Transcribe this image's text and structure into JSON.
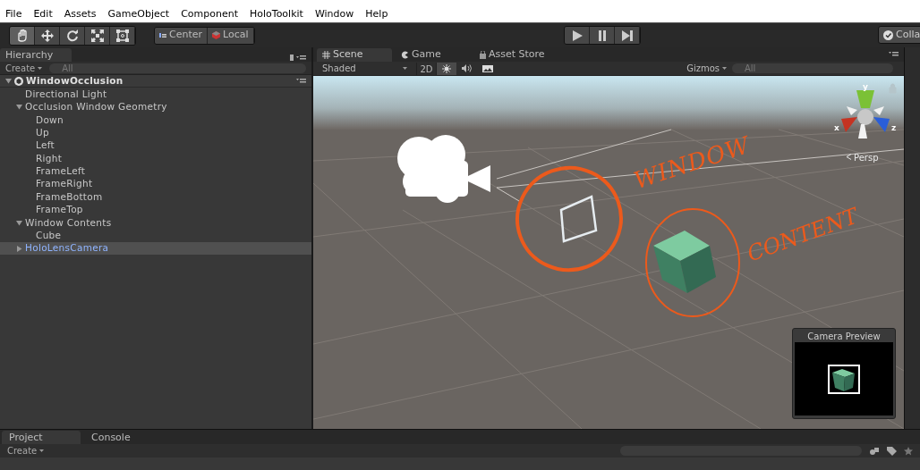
{
  "menu": [
    "File",
    "Edit",
    "Assets",
    "GameObject",
    "Component",
    "HoloToolkit",
    "Window",
    "Help"
  ],
  "toolbar": {
    "tools": [
      {
        "kind": "hand",
        "selected": true
      },
      {
        "kind": "move",
        "selected": false
      },
      {
        "kind": "rotate",
        "selected": false
      },
      {
        "kind": "scale",
        "selected": false
      },
      {
        "kind": "rect",
        "selected": false
      }
    ],
    "pivot": [
      "Center",
      "Local"
    ],
    "collab": "Colla"
  },
  "hierarchy": {
    "tab": "Hierarchy",
    "create": "Create",
    "search": {
      "placeholder": "All"
    },
    "tree": [
      {
        "label": "WindowOcclusion",
        "kind": "scene",
        "expanded": true,
        "selected": false,
        "children": [
          {
            "label": "Directional Light",
            "kind": "object",
            "selected": false
          },
          {
            "label": "Occlusion Window Geometry",
            "kind": "object",
            "expanded": true,
            "selected": false,
            "children": [
              {
                "label": "Down",
                "kind": "object",
                "selected": false
              },
              {
                "label": "Up",
                "kind": "object",
                "selected": false
              },
              {
                "label": "Left",
                "kind": "object",
                "selected": false
              },
              {
                "label": "Right",
                "kind": "object",
                "selected": false
              },
              {
                "label": "FrameLeft",
                "kind": "object",
                "selected": false
              },
              {
                "label": "FrameRight",
                "kind": "object",
                "selected": false
              },
              {
                "label": "FrameBottom",
                "kind": "object",
                "selected": false
              },
              {
                "label": "FrameTop",
                "kind": "object",
                "selected": false
              }
            ]
          },
          {
            "label": "Window Contents",
            "kind": "object",
            "expanded": true,
            "selected": false,
            "children": [
              {
                "label": "Cube",
                "kind": "object",
                "selected": false
              }
            ]
          },
          {
            "label": "HoloLensCamera",
            "kind": "prefab",
            "expanded": false,
            "selected": true
          }
        ]
      }
    ]
  },
  "scene_view": {
    "tabs": [
      {
        "label": "Scene",
        "kind": "scene",
        "selected": true
      },
      {
        "label": "Game",
        "kind": "game",
        "selected": false
      },
      {
        "label": "Asset Store",
        "kind": "store",
        "selected": false
      }
    ],
    "shading": "Shaded",
    "mode_2d": "2D",
    "lighting_on": true,
    "audio_on": false,
    "gizmos": "Gizmos",
    "search": {
      "placeholder": "All"
    },
    "axes": [
      "y",
      "x",
      "z"
    ],
    "projection": "Persp",
    "annotations": [
      "WINDOW",
      "CONTENT"
    ],
    "camera_preview": {
      "title": "Camera Preview"
    }
  },
  "bottom_panel": {
    "tabs": [
      {
        "label": "Project",
        "selected": true
      },
      {
        "label": "Console",
        "selected": false
      }
    ],
    "create": "Create"
  }
}
